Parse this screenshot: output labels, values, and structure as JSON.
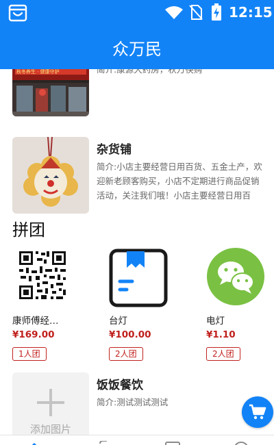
{
  "status_bar": {
    "time": "12:15"
  },
  "header": {
    "title": "众万民"
  },
  "shops": [
    {
      "name": "",
      "desc": "简介:康源大药房，秋万筷购"
    },
    {
      "name": "杂货铺",
      "desc": "简介:小店主要经营日用百货、五金土产，欢迎新老顾客购买，小店不定期进行商品促销活动，关注我们哦！小店主要经营日用百货、…"
    },
    {
      "name": "饭饭餐饮",
      "desc": "简介:测试测试测试",
      "image_placeholder": "添加图片"
    }
  ],
  "group_buy": {
    "title": "拼团",
    "items": [
      {
        "name": "康师傅经…",
        "price": "¥169.00",
        "tag": "1人团"
      },
      {
        "name": "台灯",
        "price": "¥100.00",
        "tag": "2人团"
      },
      {
        "name": "电灯",
        "price": "¥1.10",
        "tag": "2人团"
      }
    ]
  },
  "colors": {
    "primary": "#1283f7",
    "price": "#c0201c",
    "wechat_green": "#7ac143"
  }
}
